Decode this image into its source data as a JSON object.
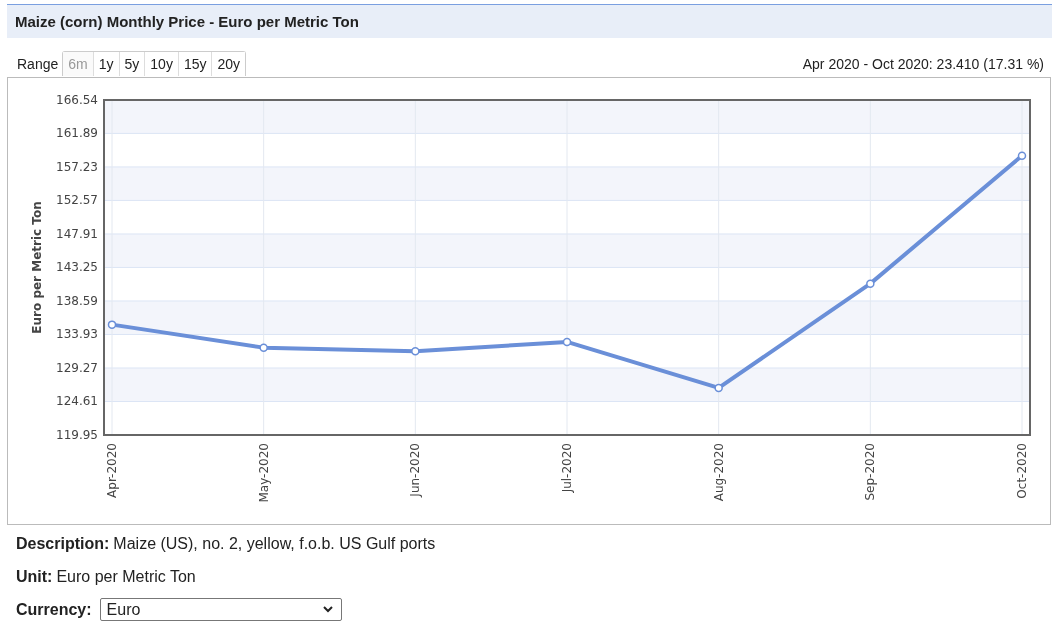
{
  "header": {
    "title": "Maize (corn) Monthly Price - Euro per Metric Ton"
  },
  "range": {
    "label": "Range",
    "options": [
      {
        "label": "6m",
        "selected": true
      },
      {
        "label": "1y",
        "selected": false
      },
      {
        "label": "5y",
        "selected": false
      },
      {
        "label": "10y",
        "selected": false
      },
      {
        "label": "15y",
        "selected": false
      },
      {
        "label": "20y",
        "selected": false
      }
    ]
  },
  "change_summary": "Apr 2020 - Oct 2020: 23.410 (17.31 %)",
  "chart": {
    "chart_data": {
      "type": "line",
      "ylabel": "Euro per Metric Ton",
      "categories": [
        "Apr-2020",
        "May-2020",
        "Jun-2020",
        "Jul-2020",
        "Aug-2020",
        "Sep-2020",
        "Oct-2020"
      ],
      "series": [
        {
          "color": "#6a8fd8",
          "marker": true,
          "values": [
            135.3,
            132.1,
            131.6,
            132.9,
            126.5,
            141.0,
            158.8
          ]
        }
      ],
      "grid": true,
      "ylim": [
        119.95,
        166.54
      ],
      "yticks": [
        {
          "value": 119.95,
          "label": "119.95"
        },
        {
          "value": 124.61,
          "label": "124.61"
        },
        {
          "value": 129.27,
          "label": "129.27"
        },
        {
          "value": 133.93,
          "label": "133.93"
        },
        {
          "value": 138.59,
          "label": "138.59"
        },
        {
          "value": 143.25,
          "label": "143.25"
        },
        {
          "value": 147.91,
          "label": "147.91"
        },
        {
          "value": 152.57,
          "label": "152.57"
        },
        {
          "value": 157.23,
          "label": "157.23"
        },
        {
          "value": 161.89,
          "label": "161.89"
        },
        {
          "value": 166.54,
          "label": "166.54"
        }
      ]
    }
  },
  "details": [
    {
      "label": "Description:",
      "value": "Maize (US), no. 2, yellow, f.o.b. US Gulf ports"
    },
    {
      "label": "Unit:",
      "value": "Euro per Metric Ton"
    }
  ],
  "currency": {
    "label": "Currency:",
    "value": "Euro"
  }
}
